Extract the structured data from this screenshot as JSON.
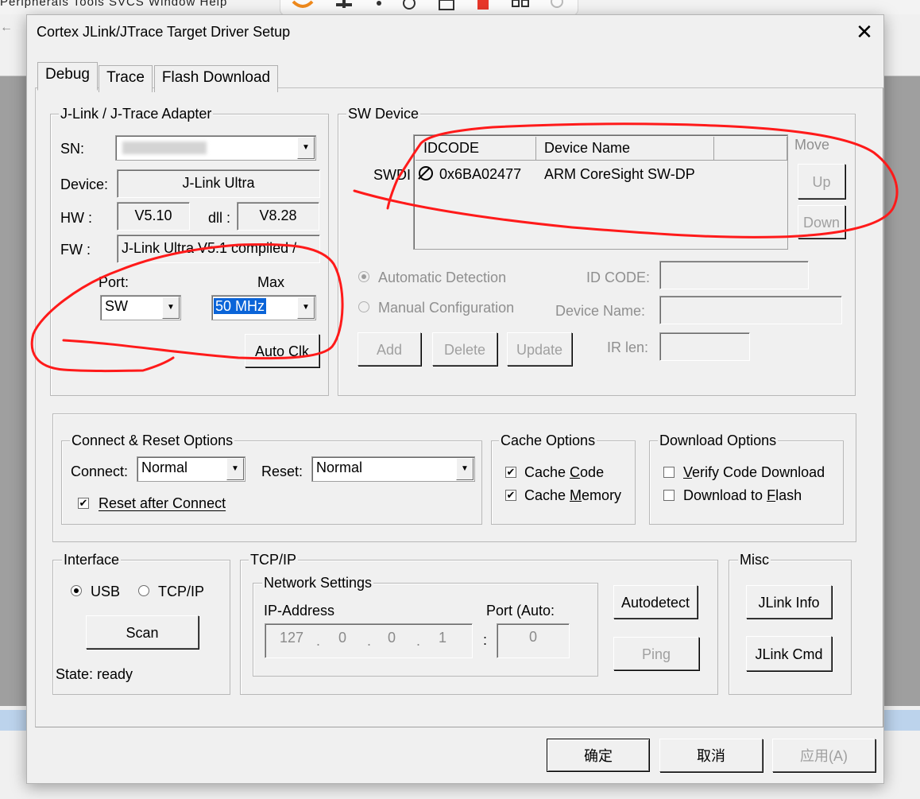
{
  "background": {
    "menu_text": "Peripherals   Tools   SVCS   Window   Help"
  },
  "dialog": {
    "title": "Cortex JLink/JTrace Target Driver Setup",
    "tabs": [
      "Debug",
      "Trace",
      "Flash Download"
    ],
    "adapter": {
      "group_title": "J-Link / J-Trace Adapter",
      "sn_label": "SN:",
      "sn_value": "",
      "device_label": "Device:",
      "device_value": "J-Link Ultra",
      "hw_label": "HW :",
      "hw_value": "V5.10",
      "dll_label": "dll :",
      "dll_value": "V8.28",
      "fw_label": "FW :",
      "fw_value": "J-Link Ultra V5.1 compiled /",
      "port_label": "Port:",
      "port_value": "SW",
      "max_label": "Max",
      "max_value": "50 MHz",
      "auto_clk_label": "Auto Clk"
    },
    "sw_device": {
      "group_title": "SW Device",
      "col_idcode": "IDCODE",
      "col_device_name": "Device Name",
      "row_prefix": "SWDI",
      "rows": [
        {
          "idcode": "0x6BA02477",
          "device_name": "ARM CoreSight SW-DP"
        }
      ],
      "move_label": "Move",
      "up_label": "Up",
      "down_label": "Down",
      "automatic_detection": "Automatic Detection",
      "manual_configuration": "Manual Configuration",
      "id_code_label": "ID CODE:",
      "device_name_label": "Device Name:",
      "ir_len_label": "IR len:",
      "add_label": "Add",
      "delete_label": "Delete",
      "update_label": "Update"
    },
    "connect_reset": {
      "group_title": "Connect & Reset Options",
      "connect_label": "Connect:",
      "connect_value": "Normal",
      "reset_label": "Reset:",
      "reset_value": "Normal",
      "reset_after_connect": "Reset after Connect"
    },
    "cache_options": {
      "group_title": "Cache Options",
      "cache_code_pre": "Cache ",
      "cache_code_u": "C",
      "cache_code_post": "ode",
      "cache_memory_pre": "Cache ",
      "cache_memory_u": "M",
      "cache_memory_post": "emory"
    },
    "download_options": {
      "group_title": "Download Options",
      "verify_u": "V",
      "verify_post": "erify Code Download",
      "flash_pre": "Download to ",
      "flash_u": "F",
      "flash_post": "lash"
    },
    "interface": {
      "group_title": "Interface",
      "usb_label": "USB",
      "tcpip_label": "TCP/IP",
      "scan_label": "Scan",
      "state_text": "State: ready"
    },
    "tcpip": {
      "group_title": "TCP/IP",
      "network_settings": "Network Settings",
      "ip_address_label": "IP-Address",
      "port_label": "Port (Auto:",
      "ip_octets": [
        "127",
        "0",
        "0",
        "1"
      ],
      "ip_dot": ".",
      "colon": ":",
      "port_value": "0",
      "autodetect_label": "Autodetect",
      "ping_label": "Ping"
    },
    "misc": {
      "group_title": "Misc",
      "jlink_info_label": "JLink Info",
      "jlink_cmd_label": "JLink Cmd"
    },
    "footer": {
      "ok_label": "确定",
      "cancel_label": "取消",
      "apply_label": "应用(A)"
    }
  },
  "colors": {
    "annotation_red": "#ff1a1a",
    "selection_blue": "#0a64d8"
  }
}
